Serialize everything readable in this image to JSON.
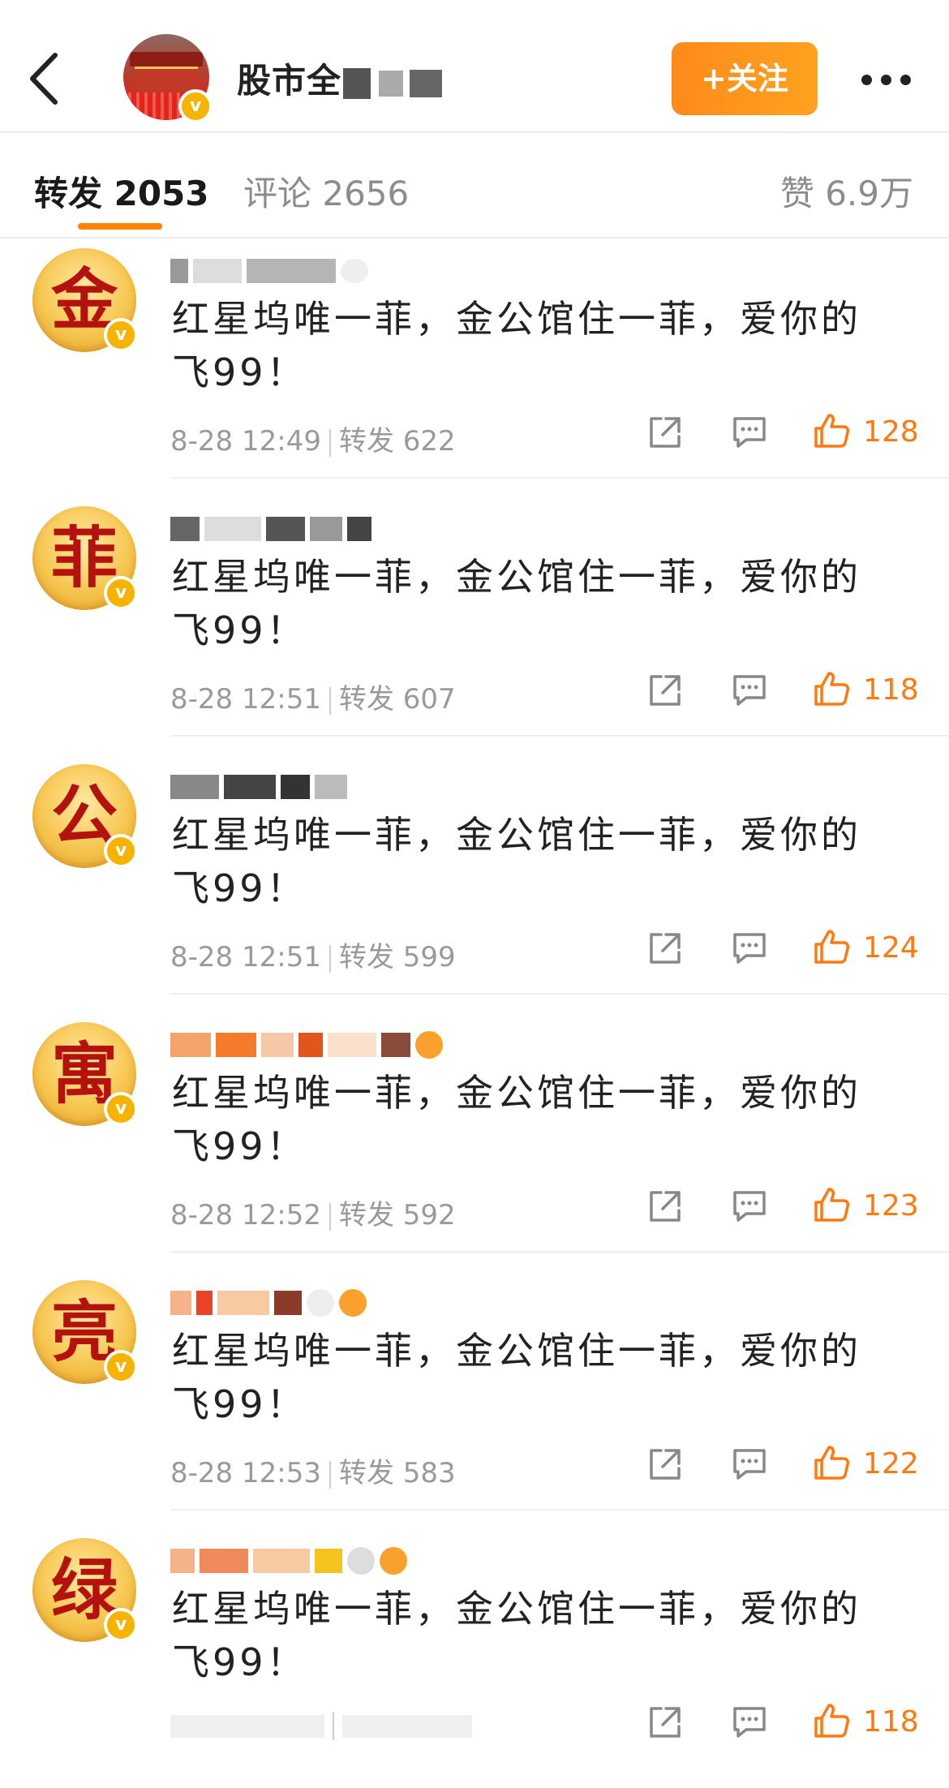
{
  "header": {
    "account_name": "股市全",
    "follow_label": "+关注"
  },
  "tabs": {
    "forward": "转发 2053",
    "comment": "评论 2656",
    "like": "赞 6.9万"
  },
  "badge_symbol": "v",
  "colors": {
    "accent": "#ff8200",
    "like": "#ff7a0e",
    "verified": "#f6b400"
  },
  "comments": [
    {
      "avatar_char": "金",
      "text": "红星坞唯一菲，金公馆住一菲，爱你的飞99！",
      "date": "8-28 12:49",
      "forward": "转发 622",
      "likes": "128"
    },
    {
      "avatar_char": "菲",
      "text": "红星坞唯一菲，金公馆住一菲，爱你的飞99！",
      "date": "8-28 12:51",
      "forward": "转发 607",
      "likes": "118"
    },
    {
      "avatar_char": "公",
      "text": "红星坞唯一菲，金公馆住一菲，爱你的飞99！",
      "date": "8-28 12:51",
      "forward": "转发 599",
      "likes": "124"
    },
    {
      "avatar_char": "寓",
      "text": "红星坞唯一菲，金公馆住一菲，爱你的飞99！",
      "date": "8-28 12:52",
      "forward": "转发 592",
      "likes": "123"
    },
    {
      "avatar_char": "亮",
      "text": "红星坞唯一菲，金公馆住一菲，爱你的飞99！",
      "date": "8-28 12:53",
      "forward": "转发 583",
      "likes": "122"
    },
    {
      "avatar_char": "绿",
      "text": "红星坞唯一菲，金公馆住一菲，爱你的飞99！",
      "date": "",
      "forward": "",
      "likes": "118"
    }
  ]
}
